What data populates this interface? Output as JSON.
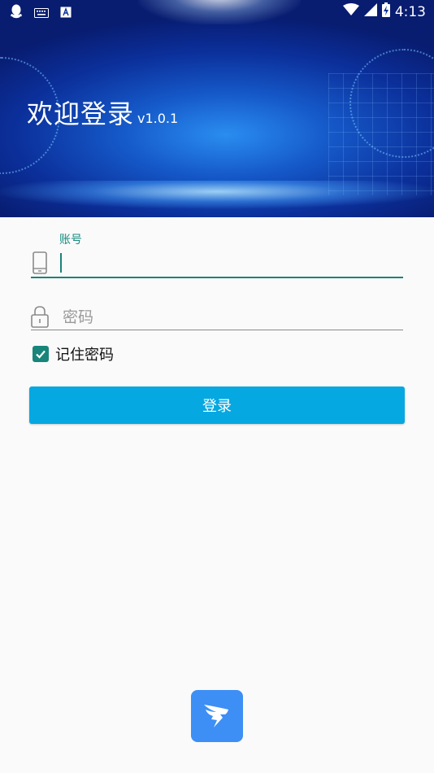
{
  "status_bar": {
    "time": "4:13",
    "icons_left": [
      "qq-icon",
      "keyboard-icon",
      "font-icon"
    ],
    "icons_right": [
      "wifi-icon",
      "signal-icon",
      "battery-charging-icon"
    ]
  },
  "header": {
    "title": "欢迎登录",
    "version": "v1.0.1"
  },
  "form": {
    "account": {
      "label": "账号",
      "value": "",
      "icon": "phone-icon"
    },
    "password": {
      "placeholder": "密码",
      "icon": "lock-icon"
    },
    "remember": {
      "label": "记住密码",
      "checked": true
    },
    "login_button": "登录"
  },
  "colors": {
    "accent": "#1a8378",
    "button": "#05a8e1",
    "logo_bg": "#3d8ff5"
  }
}
